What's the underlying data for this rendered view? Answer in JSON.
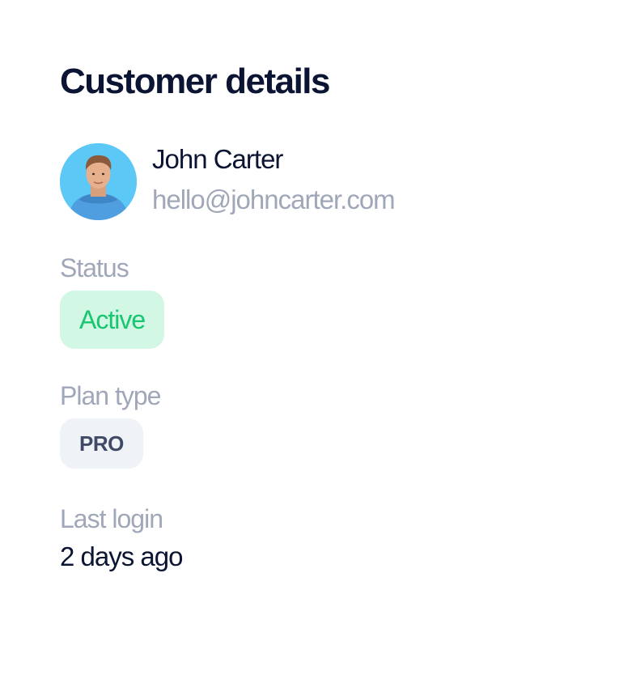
{
  "panel": {
    "title": "Customer details"
  },
  "customer": {
    "name": "John Carter",
    "email": "hello@johncarter.com",
    "avatar_icon": "user-avatar-photo"
  },
  "status": {
    "label": "Status",
    "value": "Active",
    "color": "#18c66f",
    "background": "#d2f7e5"
  },
  "plan": {
    "label": "Plan type",
    "value": "PRO"
  },
  "last_login": {
    "label": "Last login",
    "value": "2 days ago"
  }
}
